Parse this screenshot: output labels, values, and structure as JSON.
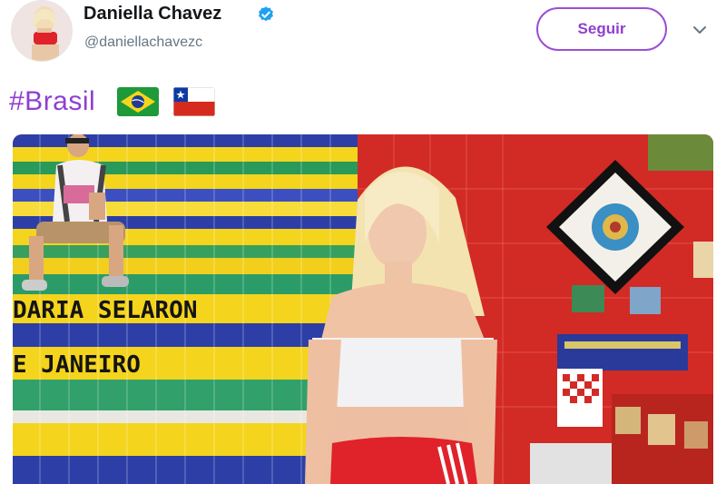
{
  "profile": {
    "display_name": "Daniella Chavez",
    "handle": "@daniellachavezc",
    "verified": true
  },
  "actions": {
    "follow_label": "Seguir",
    "more_icon": "chevron-down-icon"
  },
  "tweet": {
    "hashtag": "#Brasil",
    "flags": [
      "brazil-flag",
      "chile-flag"
    ],
    "photo": {
      "signage_line1": "DARIA SELARON",
      "signage_line2": "E JANEIRO"
    }
  },
  "colors": {
    "accent": "#8e3fd0",
    "verified": "#1da1f2",
    "tile_red": "#d8322b",
    "tile_yellow": "#f4d41c",
    "tile_blue": "#2d3fa7"
  }
}
